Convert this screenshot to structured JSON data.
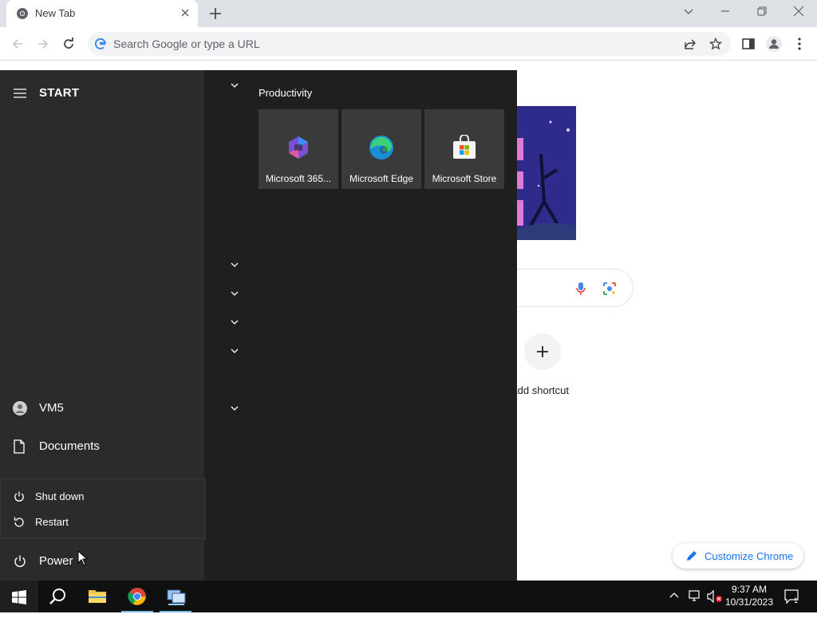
{
  "browser": {
    "tab_title": "New Tab",
    "omnibox_placeholder": "Search Google or type a URL"
  },
  "new_tab_page": {
    "add_shortcut_label": "Add shortcut",
    "customize_label": "Customize Chrome"
  },
  "start_menu": {
    "title": "START",
    "user_name": "VM5",
    "documents_label": "Documents",
    "power_label": "Power",
    "power_options": [
      "Shut down",
      "Restart"
    ],
    "group_title": "Productivity",
    "tiles": [
      {
        "label": "Microsoft 365...",
        "icon": "microsoft-365-icon"
      },
      {
        "label": "Microsoft Edge",
        "icon": "edge-icon"
      },
      {
        "label": "Microsoft Store",
        "icon": "store-icon"
      }
    ]
  },
  "taskbar": {
    "time": "9:37 AM",
    "date": "10/31/2023",
    "notification_count": "1"
  },
  "colors": {
    "start_bg": "#1f1f1f",
    "start_left_bg": "#2b2b2b",
    "tile_bg": "#3a3a3a",
    "taskbar_bg": "#101010",
    "accent": "#1a73e8"
  }
}
